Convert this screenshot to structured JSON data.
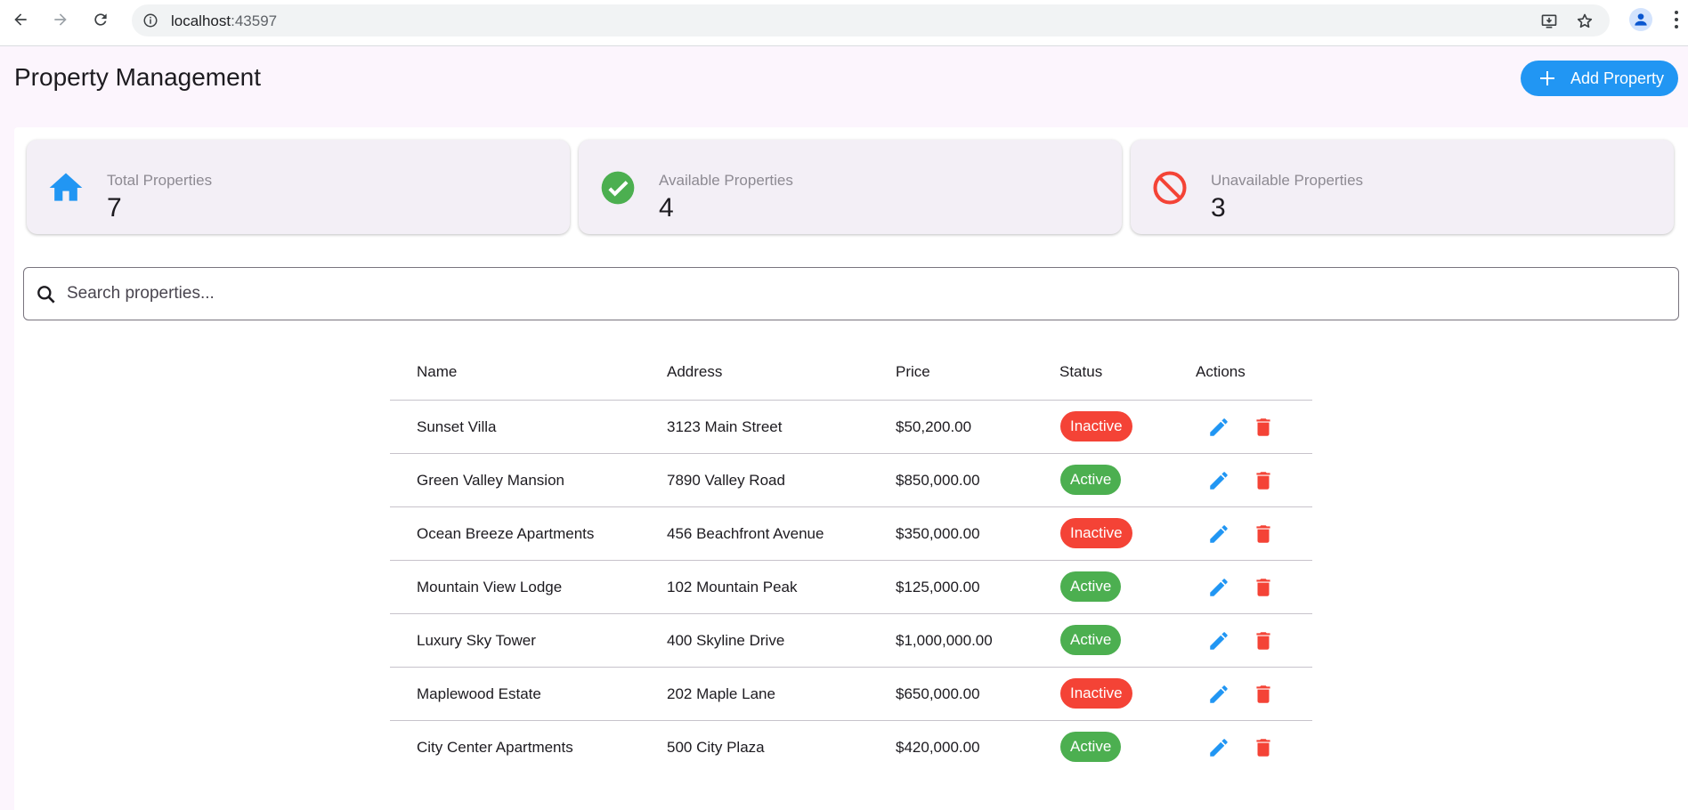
{
  "browser": {
    "url_host": "localhost",
    "url_port": ":43597"
  },
  "header": {
    "title": "Property Management",
    "add_button_label": "Add Property"
  },
  "stats": [
    {
      "label": "Total Properties",
      "value": "7",
      "icon": "home-icon",
      "color": "#2196f3"
    },
    {
      "label": "Available Properties",
      "value": "4",
      "icon": "check-circle-icon",
      "color": "#4caf50"
    },
    {
      "label": "Unavailable Properties",
      "value": "3",
      "icon": "block-icon",
      "color": "#f44336"
    }
  ],
  "search": {
    "placeholder": "Search properties...",
    "value": ""
  },
  "table": {
    "columns": [
      "Name",
      "Address",
      "Price",
      "Status",
      "Actions"
    ],
    "rows": [
      {
        "name": "Sunset Villa",
        "address": "3123 Main Street",
        "price": "$50,200.00",
        "status": "Inactive"
      },
      {
        "name": "Green Valley Mansion",
        "address": "7890 Valley Road",
        "price": "$850,000.00",
        "status": "Active"
      },
      {
        "name": "Ocean Breeze Apartments",
        "address": "456 Beachfront Avenue",
        "price": "$350,000.00",
        "status": "Inactive"
      },
      {
        "name": "Mountain View Lodge",
        "address": "102 Mountain Peak",
        "price": "$125,000.00",
        "status": "Active"
      },
      {
        "name": "Luxury Sky Tower",
        "address": "400 Skyline Drive",
        "price": "$1,000,000.00",
        "status": "Active"
      },
      {
        "name": "Maplewood Estate",
        "address": "202 Maple Lane",
        "price": "$650,000.00",
        "status": "Inactive"
      },
      {
        "name": "City Center Apartments",
        "address": "500 City Plaza",
        "price": "$420,000.00",
        "status": "Active"
      }
    ],
    "action_icons": [
      "edit-icon",
      "delete-icon"
    ]
  },
  "colors": {
    "primary": "#2196f3",
    "active": "#4caf50",
    "inactive": "#f44336"
  }
}
